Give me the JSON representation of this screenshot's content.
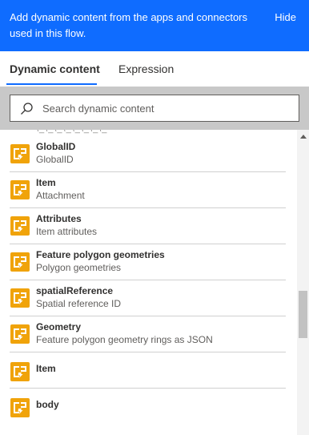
{
  "banner": {
    "message": "Add dynamic content from the apps and connectors used in this flow.",
    "hide_label": "Hide"
  },
  "tabs": [
    {
      "label": "Dynamic content",
      "active": true
    },
    {
      "label": "Expression",
      "active": false
    }
  ],
  "search": {
    "placeholder": "Search dynamic content",
    "value": ""
  },
  "list": {
    "cut_off_label": "ГИ\\_\\_\\_\\_\\_\\_\\_\\_",
    "items": [
      {
        "name": "GlobalID",
        "description": "GlobalID",
        "icon": "flow-action-icon"
      },
      {
        "name": "Item",
        "description": "Attachment",
        "icon": "flow-action-icon"
      },
      {
        "name": "Attributes",
        "description": "Item attributes",
        "icon": "flow-action-icon"
      },
      {
        "name": "Feature polygon geometries",
        "description": "Polygon geometries",
        "icon": "flow-action-icon"
      },
      {
        "name": "spatialReference",
        "description": "Spatial reference ID",
        "icon": "flow-action-icon"
      },
      {
        "name": "Geometry",
        "description": "Feature polygon geometry rings as JSON",
        "icon": "flow-action-icon"
      },
      {
        "name": "Item",
        "description": "",
        "icon": "flow-action-icon"
      },
      {
        "name": "body",
        "description": "",
        "icon": "flow-action-icon"
      }
    ]
  },
  "colors": {
    "accent": "#0f6cff",
    "icon_bg": "#f0a30a",
    "search_band": "#c8c8c8"
  }
}
